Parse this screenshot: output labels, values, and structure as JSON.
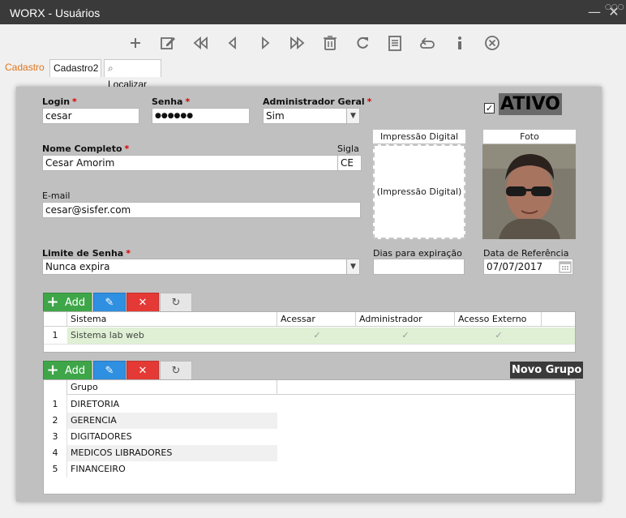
{
  "window": {
    "title": "WORX - Usuários",
    "min_glyph": "—",
    "close_glyph": "✕",
    "corner_glyph": "· ○○○"
  },
  "toolbar": {
    "buttons": [
      {
        "name": "add-icon",
        "title": "Novo"
      },
      {
        "name": "edit-icon",
        "title": "Editar"
      },
      {
        "name": "first-record-icon",
        "title": "Primeiro"
      },
      {
        "name": "previous-record-icon",
        "title": "Anterior"
      },
      {
        "name": "next-record-icon",
        "title": "Próximo"
      },
      {
        "name": "last-record-icon",
        "title": "Último"
      },
      {
        "name": "delete-icon",
        "title": "Excluir"
      },
      {
        "name": "refresh-icon",
        "title": "Atualizar"
      },
      {
        "name": "report-icon",
        "title": "Relatório"
      },
      {
        "name": "undo-icon",
        "title": "Desfazer"
      },
      {
        "name": "info-icon",
        "title": "Informações"
      },
      {
        "name": "close-circle-icon",
        "title": "Fechar"
      }
    ]
  },
  "tabs": [
    {
      "label": "Cadastro",
      "active": true
    },
    {
      "label": "Cadastro2",
      "active": false
    },
    {
      "label": "Localizar",
      "active": false
    }
  ],
  "form": {
    "login": {
      "label": "Login",
      "value": "cesar"
    },
    "senha": {
      "label": "Senha",
      "value": "●●●●●●"
    },
    "admin_geral": {
      "label": "Administrador Geral",
      "value": "Sim"
    },
    "ativo": {
      "label": "ATIVO",
      "checked": true,
      "check_glyph": "✓"
    },
    "nome_completo": {
      "label": "Nome Completo",
      "value": "Cesar Amorim"
    },
    "sigla": {
      "label": "Sigla",
      "value": "CE"
    },
    "email": {
      "label": "E-mail",
      "value": "cesar@sisfer.com"
    },
    "impressao_digital": {
      "caption": "Impressão Digital",
      "placeholder": "(Impressão Digital)"
    },
    "foto": {
      "caption": "Foto"
    },
    "limite_senha": {
      "label": "Limite de Senha",
      "value": "Nunca expira"
    },
    "dias_expiracao": {
      "label": "Dias para expiração",
      "value": ""
    },
    "data_referencia": {
      "label": "Data de Referência",
      "value": "07/07/2017"
    },
    "required_mark": "*"
  },
  "grid_buttons": {
    "add_label": "Add",
    "plus": "+",
    "edit_glyph": "✎",
    "delete_glyph": "✕",
    "refresh_glyph": "↻"
  },
  "sistemas_grid": {
    "columns": [
      "Sistema",
      "Acessar",
      "Administrador",
      "Acesso Externo"
    ],
    "rows": [
      {
        "num": "1",
        "sistema": "Sistema lab web",
        "acessar": true,
        "administrador": true,
        "acesso_externo": true
      }
    ],
    "check_glyph": "✓"
  },
  "grupos_grid": {
    "novo_grupo_label": "Novo Grupo",
    "columns": [
      "Grupo"
    ],
    "rows": [
      {
        "num": "1",
        "grupo": "DIRETORIA"
      },
      {
        "num": "2",
        "grupo": "GERENCIA"
      },
      {
        "num": "3",
        "grupo": "DIGITADORES"
      },
      {
        "num": "4",
        "grupo": "MEDICOS LIBRADORES"
      },
      {
        "num": "5",
        "grupo": "FINANCEIRO"
      }
    ]
  },
  "colors": {
    "titlebar": "#3a3a3a",
    "active_tab": "#e0761c",
    "panel": "#c0c0c0",
    "add_button": "#3ea648",
    "edit_button": "#2f8fe0",
    "delete_button": "#e53935",
    "selected_row": "#dff0d4",
    "required": "#dd0000"
  }
}
